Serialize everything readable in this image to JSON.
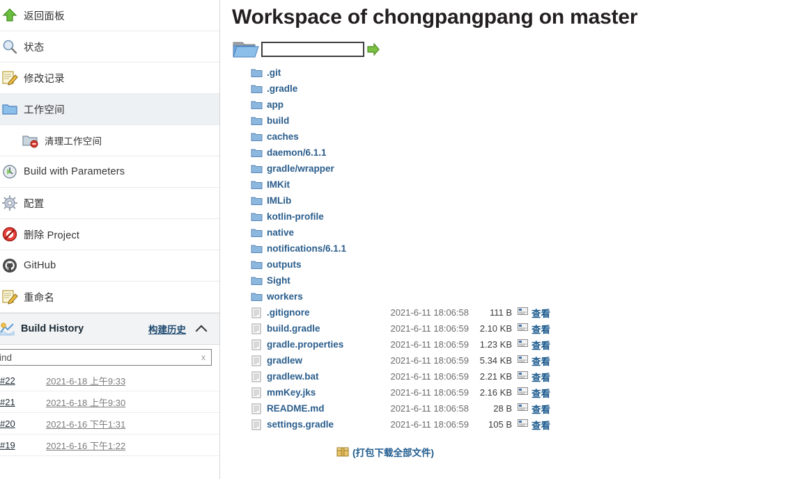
{
  "sidebar": {
    "tasks": [
      {
        "label": "返回面板",
        "icon": "up-arrow-icon",
        "sub": false,
        "selected": false
      },
      {
        "label": "状态",
        "icon": "magnifier-icon",
        "sub": false,
        "selected": false
      },
      {
        "label": "修改记录",
        "icon": "notepad-pencil-icon",
        "sub": false,
        "selected": false
      },
      {
        "label": "工作空间",
        "icon": "folder-icon",
        "sub": false,
        "selected": true
      },
      {
        "label": "清理工作空间",
        "icon": "folder-delete-icon",
        "sub": true,
        "selected": false
      },
      {
        "label": "Build with Parameters",
        "icon": "clock-run-icon",
        "sub": false,
        "selected": false
      },
      {
        "label": "配置",
        "icon": "gear-icon",
        "sub": false,
        "selected": false
      },
      {
        "label": "删除 Project",
        "icon": "delete-forbidden-icon",
        "sub": false,
        "selected": false
      },
      {
        "label": "GitHub",
        "icon": "github-icon",
        "sub": false,
        "selected": false
      },
      {
        "label": "重命名",
        "icon": "notepad-pencil-icon",
        "sub": false,
        "selected": false
      }
    ],
    "build_history": {
      "title": "Build History",
      "link_label": "构建历史",
      "collapse_icon": "chevron-up-icon",
      "search_value": "ind",
      "search_clear_label": "x",
      "builds": [
        {
          "number": "#22",
          "time": "2021-6-18 上午9:33"
        },
        {
          "number": "#21",
          "time": "2021-6-18 上午9:30"
        },
        {
          "number": "#20",
          "time": "2021-6-16 下午1:31"
        },
        {
          "number": "#19",
          "time": "2021-6-16 下午1:22"
        }
      ]
    }
  },
  "main": {
    "title": "Workspace of chongpangpang on master",
    "path_input_value": "",
    "path_go_label": "go-arrow-icon",
    "directories": [
      ".git",
      ".gradle",
      "app",
      "build",
      "caches",
      "daemon/6.1.1",
      "gradle/wrapper",
      "IMKit",
      "IMLib",
      "kotlin-profile",
      "native",
      "notifications/6.1.1",
      "outputs",
      "Sight",
      "workers"
    ],
    "view_label": "查看",
    "files": [
      {
        "name": ".gitignore",
        "date": "2021-6-11 18:06:58",
        "size": "111 B"
      },
      {
        "name": "build.gradle",
        "date": "2021-6-11 18:06:59",
        "size": "2.10 KB"
      },
      {
        "name": "gradle.properties",
        "date": "2021-6-11 18:06:59",
        "size": "1.23 KB"
      },
      {
        "name": "gradlew",
        "date": "2021-6-11 18:06:59",
        "size": "5.34 KB"
      },
      {
        "name": "gradlew.bat",
        "date": "2021-6-11 18:06:59",
        "size": "2.21 KB"
      },
      {
        "name": "mmKey.jks",
        "date": "2021-6-11 18:06:59",
        "size": "2.16 KB"
      },
      {
        "name": "README.md",
        "date": "2021-6-11 18:06:58",
        "size": "28 B"
      },
      {
        "name": "settings.gradle",
        "date": "2021-6-11 18:06:59",
        "size": "105 B"
      }
    ],
    "download_all_label": "(打包下载全部文件)"
  },
  "colors": {
    "link": "#2a5d8c",
    "view_link": "#1d5a8e",
    "selected_row": "#eef1f3",
    "folder_blue": "#7ba7d7",
    "go_green": "#6ab82e"
  }
}
